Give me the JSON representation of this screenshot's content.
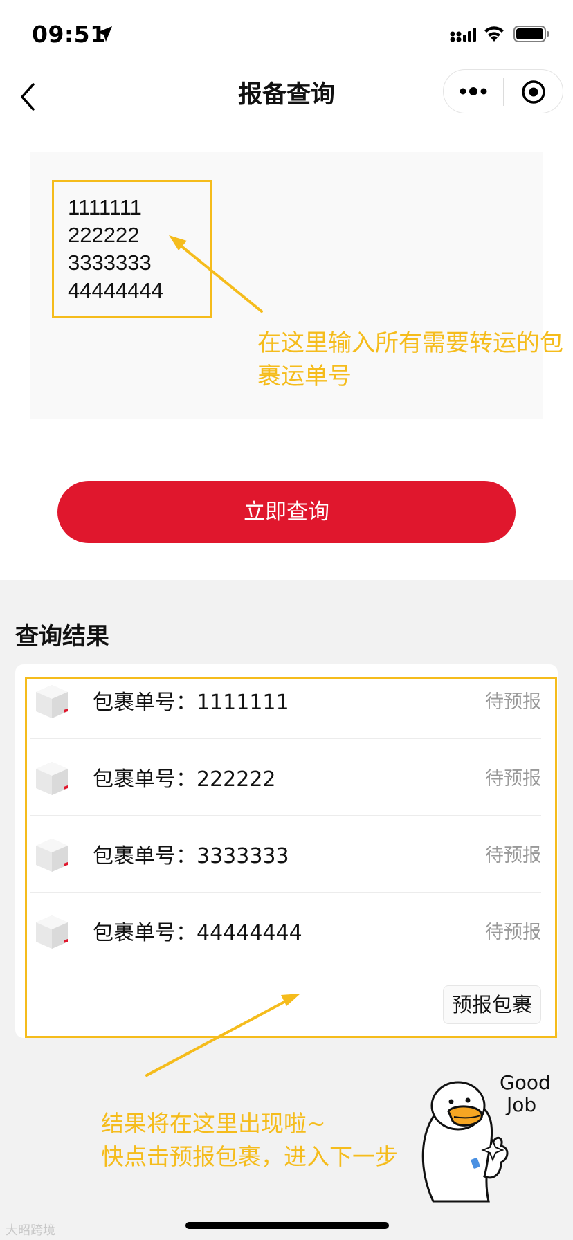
{
  "status_bar": {
    "time": "09:51"
  },
  "nav": {
    "title": "报备查询"
  },
  "input": {
    "lines": [
      "1111111",
      "222222",
      "3333333",
      "44444444"
    ]
  },
  "annotations": {
    "input_hint_line1": "在这里输入所有需要转运的包",
    "input_hint_line2": "裹运单号",
    "result_hint_line1": "结果将在这里出现啦~",
    "result_hint_line2": "快点击预报包裹，进入下一步",
    "accent_color": "#f5bc1c"
  },
  "query_button": {
    "label": "立即查询",
    "color": "#e0172d"
  },
  "results": {
    "title": "查询结果",
    "rows": [
      {
        "label": "包裹单号：1111111",
        "status": "待预报"
      },
      {
        "label": "包裹单号：222222",
        "status": "待预报"
      },
      {
        "label": "包裹单号：3333333",
        "status": "待预报"
      },
      {
        "label": "包裹单号：44444444",
        "status": "待预报"
      }
    ],
    "action_label": "预报包裹"
  },
  "sticker": {
    "text_line1": "Good",
    "text_line2": "Job"
  },
  "watermark": "大昭跨境"
}
